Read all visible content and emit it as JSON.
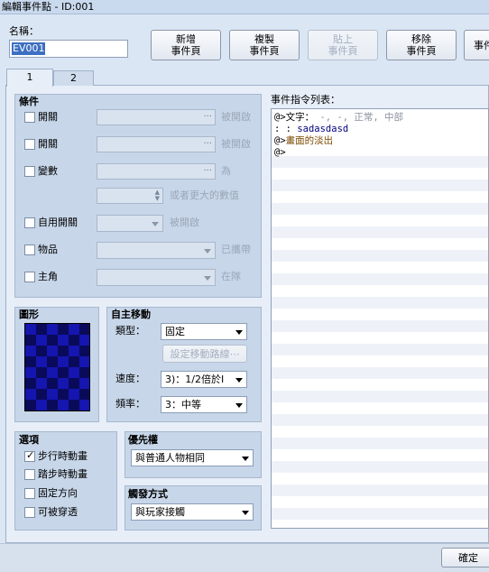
{
  "window": {
    "title": "編輯事件點 - ID:001"
  },
  "name_field": {
    "label": "名稱：",
    "value": "EV001"
  },
  "toolbar": {
    "new_page": [
      "新增",
      "事件頁"
    ],
    "copy_page": [
      "複製",
      "事件頁"
    ],
    "paste_page": [
      "貼上",
      "事件頁"
    ],
    "delete_page": [
      "移除",
      "事件頁"
    ],
    "clear_page": [
      "",
      "事件"
    ]
  },
  "tabs": [
    "1",
    "2"
  ],
  "conditions": {
    "heading": "條件",
    "switch1": {
      "label": "開關",
      "suffix": "被開啟"
    },
    "switch2": {
      "label": "開關",
      "suffix": "被開啟"
    },
    "variable": {
      "label": "變數",
      "suffix": "為"
    },
    "variable_or_more": "或者更大的數值",
    "self_switch": {
      "label": "自用開關",
      "suffix": "被開啟"
    },
    "item": {
      "label": "物品",
      "suffix": "已攜帶"
    },
    "actor": {
      "label": "主角",
      "suffix": "在隊"
    }
  },
  "graphic": {
    "heading": "圖形"
  },
  "autonomous": {
    "heading": "自主移動",
    "type_label": "類型：",
    "type_value": "固定",
    "route_button": "設定移動路線⋯",
    "speed_label": "速度：",
    "speed_value": "3)：1/2倍於Ⅰ",
    "freq_label": "頻率：",
    "freq_value": "3：中等"
  },
  "options": {
    "heading": "選項",
    "walking_anim": {
      "label": "步行時動畫",
      "checked": true
    },
    "stepping_anim": {
      "label": "踏步時動畫",
      "checked": false
    },
    "direction_fix": {
      "label": "固定方向",
      "checked": false
    },
    "through": {
      "label": "可被穿透",
      "checked": false
    }
  },
  "priority": {
    "heading": "優先權",
    "value": "與普通人物相同"
  },
  "trigger": {
    "heading": "觸發方式",
    "value": "與玩家接觸"
  },
  "command_list": {
    "heading": "事件指令列表：",
    "lines": [
      {
        "prefix": "@>",
        "text": "文字：",
        "extra": "-, -, 正常, 中部",
        "color": "#000000"
      },
      {
        "prefix": "  :",
        "text": "    :",
        "extra": "sadasdasd",
        "color": "#000080"
      },
      {
        "prefix": "@>",
        "text": "畫面的淡出",
        "extra": "",
        "color": "#7a4a00"
      },
      {
        "prefix": "@>",
        "text": "",
        "extra": "",
        "color": "#000000"
      }
    ]
  },
  "footer": {
    "ok_button": "確定"
  },
  "colors": {
    "graphic_dark": "#0a0a5a",
    "graphic_light": "#1515b0"
  }
}
